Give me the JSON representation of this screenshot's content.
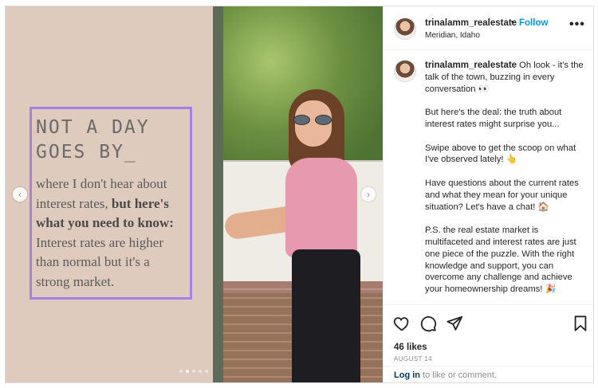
{
  "post_image": {
    "heading": "NOT A DAY GOES BY_",
    "body_plain": "where I don't hear about interest rates,",
    "body_bold": "but here's what you need to know:",
    "body_end": "Interest rates are higher than normal but it's a strong market.",
    "prev_arrow": "‹",
    "next_arrow": "›",
    "carousel_dots": 5,
    "active_dot": 1
  },
  "header": {
    "username": "trinalamm_realestate",
    "separator": "•",
    "follow_label": "Follow",
    "location": "Meridian, Idaho",
    "more_label": "•••"
  },
  "caption": {
    "username": "trinalamm_realestate",
    "paragraphs": [
      "Oh look - it's the talk of the town, buzzing in every conversation 👀",
      "But here's the deal: the truth about interest rates might surprise you...",
      "Swipe above to get the scoop on what I've observed lately! 👆",
      "Have questions about the current rates and what they mean for your unique situation? Let's have a chat! 🏠",
      "P.S. the real estate market is multifaceted and interest rates are just one piece of the puzzle. With the right knowledge and support, you can overcome any challenge and achieve your homeownership dreams! 🎉"
    ]
  },
  "actions": {
    "icons": [
      "heart-icon",
      "comment-icon",
      "share-icon",
      "bookmark-icon"
    ],
    "likes": "46 likes",
    "date": "AUGUST 14"
  },
  "login_prompt": {
    "link": "Log in",
    "rest": " to like or comment."
  },
  "colors": {
    "accent_follow": "#0095f6",
    "quote_border": "#a97fe6",
    "left_panel_bg": "#dfcbbd"
  }
}
